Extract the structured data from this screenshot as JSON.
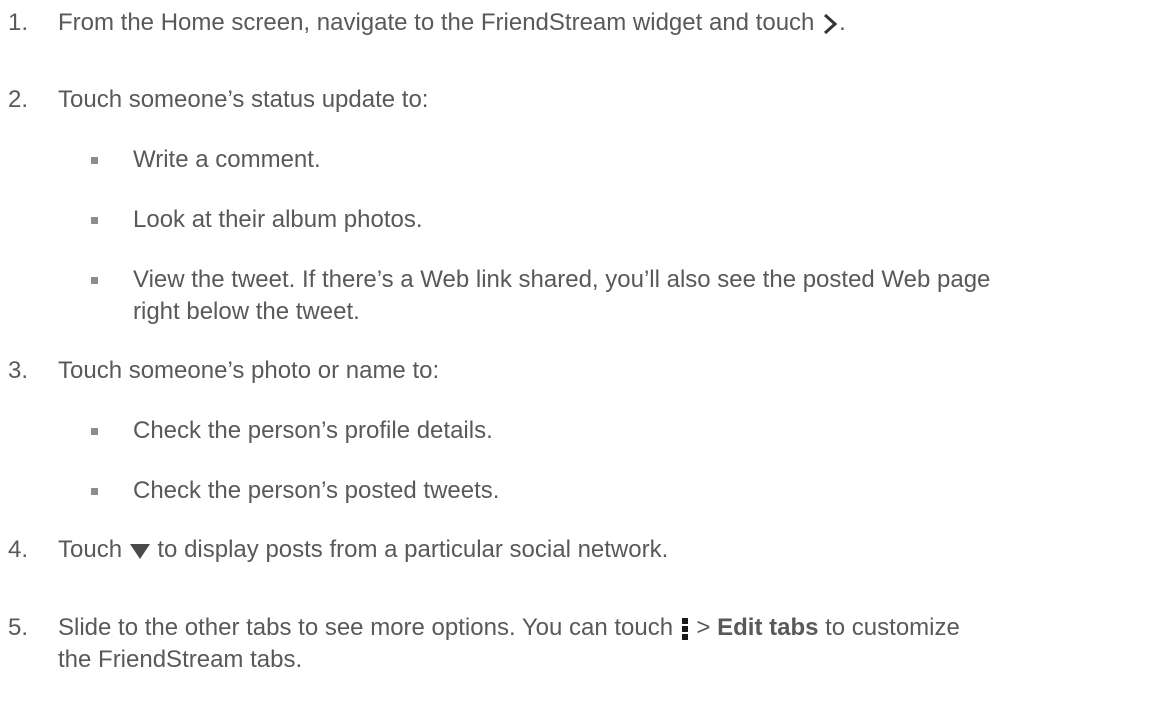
{
  "steps": [
    {
      "number": "1.",
      "text_before_icon": "From the Home screen, navigate to the FriendStream widget and touch ",
      "icon": "chevron-right-icon",
      "text_after_icon": "."
    },
    {
      "number": "2.",
      "text": "Touch someone’s status update to:",
      "bullets": [
        "Write a comment.",
        "Look at their album photos.",
        "View the tweet. If there’s a Web link shared, you’ll also see the posted Web page",
        "right below the tweet."
      ]
    },
    {
      "number": "3.",
      "text": "Touch someone’s photo or name to:",
      "bullets": [
        "Check the person’s profile details.",
        "Check the person’s posted tweets."
      ]
    },
    {
      "number": "4.",
      "text_before_icon": "Touch ",
      "icon": "triangle-down-icon",
      "text_after_icon": " to display posts from a particular social network."
    },
    {
      "number": "5.",
      "text_before_icon": "Slide to the other tabs to see more options. You can touch ",
      "icon": "menu-icon",
      "text_mid": " > ",
      "bold_text": "Edit tabs",
      "text_after_bold": " to customize",
      "continuation": "the FriendStream tabs."
    }
  ]
}
